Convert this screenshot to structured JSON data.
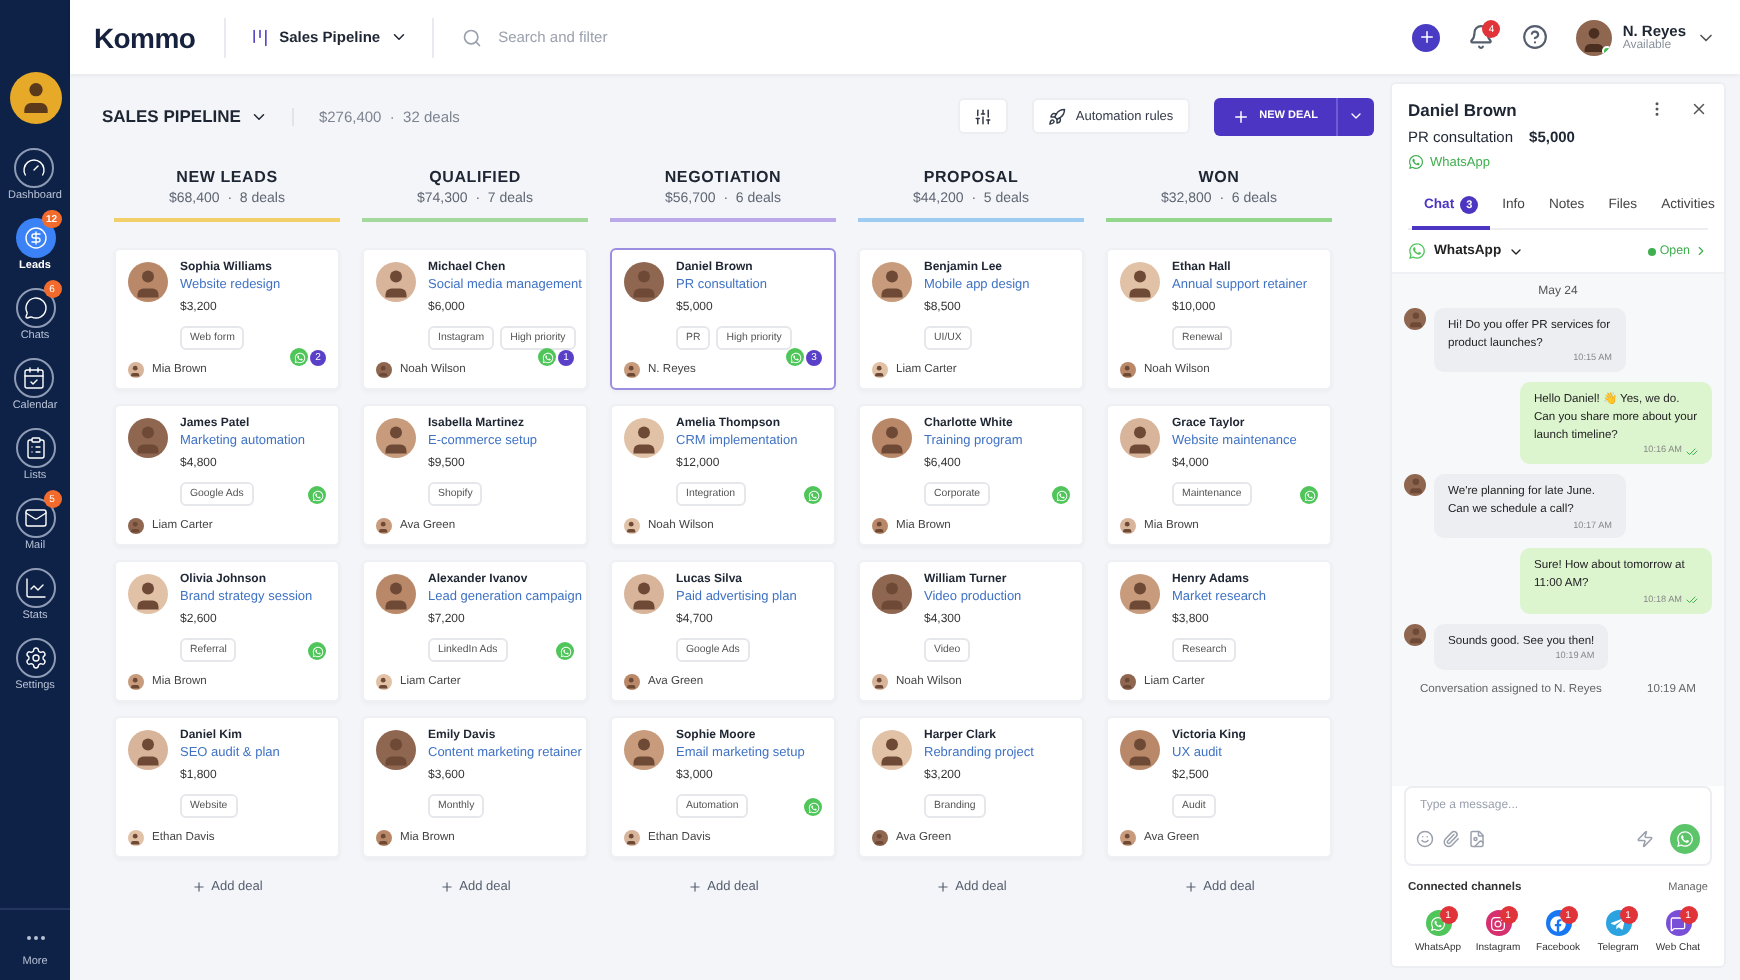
{
  "sidebar": {
    "items": [
      {
        "label": "Dashboard",
        "selected": false
      },
      {
        "label": "Leads",
        "selected": true,
        "badge": "12"
      },
      {
        "label": "Chats",
        "selected": false,
        "badge": "6"
      },
      {
        "label": "Calendar",
        "selected": false
      },
      {
        "label": "Lists",
        "selected": false
      },
      {
        "label": "Mail",
        "selected": false,
        "badge": "5"
      },
      {
        "label": "Stats",
        "selected": false
      },
      {
        "label": "Settings",
        "selected": false
      }
    ],
    "more": "More"
  },
  "topbar": {
    "logo": "Kommo",
    "pipeline": "Sales Pipeline",
    "search": {
      "placeholder": "Search and filter"
    },
    "notifications": "4",
    "user": {
      "name": "N. Reyes",
      "status": "Available"
    }
  },
  "toolbar": {
    "title": "SALES PIPELINE",
    "summary": "$276,400  ·  32 deals",
    "automation": "Automation rules",
    "new_deal": "NEW DEAL"
  },
  "columns": [
    {
      "title": "NEW LEADS",
      "summary": "$68,400  ·  8 deals",
      "color": "#f3cf6a",
      "add": "Add deal",
      "cards": [
        {
          "name": "Sophia Williams",
          "deal": "Website redesign",
          "amount": "$3,200",
          "tags": [
            "Web form"
          ],
          "whatsapp": true,
          "unread": "2",
          "owner": "Mia Brown",
          "selected": false
        },
        {
          "name": "James Patel",
          "deal": "Marketing automation",
          "amount": "$4,800",
          "tags": [
            "Google Ads"
          ],
          "whatsapp": true,
          "owner": "Liam Carter",
          "selected": false
        },
        {
          "name": "Olivia Johnson",
          "deal": "Brand strategy session",
          "amount": "$2,600",
          "tags": [
            "Referral"
          ],
          "whatsapp": true,
          "owner": "Mia Brown",
          "selected": false
        },
        {
          "name": "Daniel Kim",
          "deal": "SEO audit & plan",
          "amount": "$1,800",
          "tags": [
            "Website"
          ],
          "whatsapp": false,
          "owner": "Ethan Davis",
          "selected": false
        }
      ]
    },
    {
      "title": "QUALIFIED",
      "summary": "$74,300  ·  7 deals",
      "color": "#a3d99c",
      "add": "Add deal",
      "cards": [
        {
          "name": "Michael Chen",
          "deal": "Social media management",
          "amount": "$6,000",
          "tags": [
            "Instagram",
            "High priority"
          ],
          "whatsapp": true,
          "unread": "1",
          "owner": "Noah Wilson",
          "selected": false
        },
        {
          "name": "Isabella Martinez",
          "deal": "E-commerce setup",
          "amount": "$9,500",
          "tags": [
            "Shopify"
          ],
          "whatsapp": false,
          "owner": "Ava Green",
          "selected": false
        },
        {
          "name": "Alexander Ivanov",
          "deal": "Lead generation campaign",
          "amount": "$7,200",
          "tags": [
            "LinkedIn Ads"
          ],
          "whatsapp": true,
          "owner": "Liam Carter",
          "selected": false
        },
        {
          "name": "Emily Davis",
          "deal": "Content marketing retainer",
          "amount": "$3,600",
          "tags": [
            "Monthly"
          ],
          "whatsapp": false,
          "owner": "Mia Brown",
          "selected": false
        }
      ]
    },
    {
      "title": "NEGOTIATION",
      "summary": "$56,700  ·  6 deals",
      "color": "#bba8e8",
      "add": "Add deal",
      "cards": [
        {
          "name": "Daniel Brown",
          "deal": "PR consultation",
          "amount": "$5,000",
          "tags": [
            "PR",
            "High priority"
          ],
          "whatsapp": true,
          "unread": "3",
          "owner": "N. Reyes",
          "selected": true
        },
        {
          "name": "Amelia Thompson",
          "deal": "CRM implementation",
          "amount": "$12,000",
          "tags": [
            "Integration"
          ],
          "whatsapp": true,
          "owner": "Noah Wilson",
          "selected": false
        },
        {
          "name": "Lucas Silva",
          "deal": "Paid advertising plan",
          "amount": "$4,700",
          "tags": [
            "Google Ads"
          ],
          "whatsapp": false,
          "owner": "Ava Green",
          "selected": false
        },
        {
          "name": "Sophie Moore",
          "deal": "Email marketing setup",
          "amount": "$3,000",
          "tags": [
            "Automation"
          ],
          "whatsapp": true,
          "owner": "Ethan Davis",
          "selected": false
        }
      ]
    },
    {
      "title": "PROPOSAL",
      "summary": "$44,200  ·  5 deals",
      "color": "#9ecbf1",
      "add": "Add deal",
      "cards": [
        {
          "name": "Benjamin Lee",
          "deal": "Mobile app design",
          "amount": "$8,500",
          "tags": [
            "UI/UX"
          ],
          "whatsapp": false,
          "owner": "Liam Carter",
          "selected": false
        },
        {
          "name": "Charlotte White",
          "deal": "Training program",
          "amount": "$6,400",
          "tags": [
            "Corporate"
          ],
          "whatsapp": true,
          "owner": "Mia Brown",
          "selected": false
        },
        {
          "name": "William Turner",
          "deal": "Video production",
          "amount": "$4,300",
          "tags": [
            "Video"
          ],
          "whatsapp": false,
          "owner": "Noah Wilson",
          "selected": false
        },
        {
          "name": "Harper Clark",
          "deal": "Rebranding project",
          "amount": "$3,200",
          "tags": [
            "Branding"
          ],
          "whatsapp": false,
          "owner": "Ava Green",
          "selected": false
        }
      ]
    },
    {
      "title": "WON",
      "summary": "$32,800  ·  6 deals",
      "color": "#92d78c",
      "add": "Add deal",
      "cards": [
        {
          "name": "Ethan Hall",
          "deal": "Annual support retainer",
          "amount": "$10,000",
          "tags": [
            "Renewal"
          ],
          "whatsapp": false,
          "owner": "Noah Wilson",
          "selected": false
        },
        {
          "name": "Grace Taylor",
          "deal": "Website maintenance",
          "amount": "$4,000",
          "tags": [
            "Maintenance"
          ],
          "whatsapp": true,
          "owner": "Mia Brown",
          "selected": false
        },
        {
          "name": "Henry Adams",
          "deal": "Market research",
          "amount": "$3,800",
          "tags": [
            "Research"
          ],
          "whatsapp": false,
          "owner": "Liam Carter",
          "selected": false
        },
        {
          "name": "Victoria King",
          "deal": "UX audit",
          "amount": "$2,500",
          "tags": [
            "Audit"
          ],
          "whatsapp": false,
          "owner": "Ava Green",
          "selected": false
        }
      ]
    }
  ],
  "panel": {
    "name": "Daniel Brown",
    "deal": "PR consultation",
    "amount": "$5,000",
    "source": "WhatsApp",
    "tabs": [
      {
        "label": "Chat",
        "badge": "3",
        "selected": true
      },
      {
        "label": "Info",
        "selected": false
      },
      {
        "label": "Notes",
        "selected": false
      },
      {
        "label": "Files",
        "selected": false
      },
      {
        "label": "Activities",
        "selected": false
      }
    ],
    "channel": "WhatsApp",
    "status": "Open",
    "date": "May 24",
    "messages": [
      {
        "kind": "in",
        "text": "Hi! Do you offer PR services for product launches?",
        "time": "10:15 AM"
      },
      {
        "kind": "out",
        "text": "Hello Daniel! 👋 Yes, we do. Can you share more about your launch timeline?",
        "time": "10:16 AM"
      },
      {
        "kind": "in",
        "text": "We're planning for late June. Can we schedule a call?",
        "time": "10:17 AM"
      },
      {
        "kind": "out",
        "text": "Sure! How about tomorrow at 11:00 AM?",
        "time": "10:18 AM"
      },
      {
        "kind": "in",
        "text": "Sounds good. See you then!",
        "time": "10:19 AM"
      },
      {
        "kind": "system",
        "text": "Conversation assigned to N. Reyes",
        "time": "10:19 AM"
      }
    ],
    "composer": {
      "placeholder": "Type a message..."
    },
    "connected": {
      "title": "Connected channels",
      "manage": "Manage",
      "channels": [
        {
          "label": "WhatsApp",
          "badge": "1"
        },
        {
          "label": "Instagram",
          "badge": "1"
        },
        {
          "label": "Facebook",
          "badge": "1"
        },
        {
          "label": "Telegram",
          "badge": "1"
        },
        {
          "label": "Web Chat",
          "badge": "1"
        }
      ]
    }
  }
}
